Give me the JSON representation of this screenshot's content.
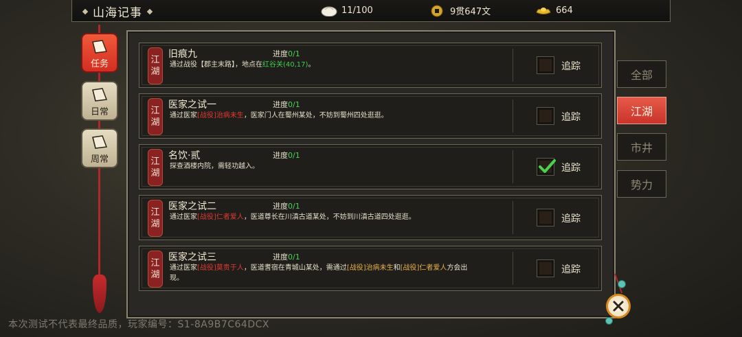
{
  "header": {
    "title": "山海记事",
    "stamina": "11/100",
    "coins": "9贯647文",
    "gold": "664"
  },
  "left_tabs": [
    {
      "label": "任务",
      "active": true
    },
    {
      "label": "日常",
      "active": false
    },
    {
      "label": "周常",
      "active": false
    }
  ],
  "right_tabs": [
    {
      "label": "全部",
      "active": false
    },
    {
      "label": "江湖",
      "active": true
    },
    {
      "label": "市井",
      "active": false
    },
    {
      "label": "势力",
      "active": false
    }
  ],
  "quests": [
    {
      "tag": [
        "江",
        "湖"
      ],
      "name": "旧痕九",
      "progress_label": "进度",
      "progress_value": "0/1",
      "desc": [
        {
          "t": "通过战役【郡主末路】，地点在",
          "c": ""
        },
        {
          "t": "红谷关(40,17)",
          "c": "grn"
        },
        {
          "t": "。",
          "c": ""
        }
      ],
      "tracked": false,
      "track_label": "追踪"
    },
    {
      "tag": [
        "江",
        "湖"
      ],
      "name": "医家之试一",
      "progress_label": "进度",
      "progress_value": "0/1",
      "desc": [
        {
          "t": "通过医家",
          "c": ""
        },
        {
          "t": "[战役]治病未生",
          "c": "red"
        },
        {
          "t": "，医家门人在蜀州某处，不妨到蜀州四处逛逛。",
          "c": ""
        }
      ],
      "tracked": false,
      "track_label": "追踪"
    },
    {
      "tag": [
        "江",
        "湖"
      ],
      "name": "名饮·贰",
      "progress_label": "进度",
      "progress_value": "0/1",
      "desc": [
        {
          "t": "探查酒楼内院，需轻功越入。",
          "c": ""
        }
      ],
      "tracked": true,
      "track_label": "追踪"
    },
    {
      "tag": [
        "江",
        "湖"
      ],
      "name": "医家之试二",
      "progress_label": "进度",
      "progress_value": "0/1",
      "desc": [
        {
          "t": "通过医家",
          "c": ""
        },
        {
          "t": "[战役]仁者爱人",
          "c": "red"
        },
        {
          "t": "，医道尊长在川滇古道某处，不妨到川滇古道四处逛逛。",
          "c": ""
        }
      ],
      "tracked": false,
      "track_label": "追踪"
    },
    {
      "tag": [
        "江",
        "湖"
      ],
      "name": "医家之试三",
      "progress_label": "进度",
      "progress_value": "0/1",
      "desc": [
        {
          "t": "通过医家",
          "c": ""
        },
        {
          "t": "[战役]莫贵于人",
          "c": "red"
        },
        {
          "t": "，医道耆宿在青城山某处，需通过",
          "c": ""
        },
        {
          "t": "[战役]治病未生",
          "c": "gold"
        },
        {
          "t": "和",
          "c": ""
        },
        {
          "t": "[战役]仁者爱人",
          "c": "gold"
        },
        {
          "t": "方会出现。",
          "c": ""
        }
      ],
      "tracked": false,
      "track_label": "追踪"
    }
  ],
  "watermark": "本次测试不代表最终品质，玩家编号：S1-8A9B7C64DCX",
  "colors": {
    "accent_red": "#d32d23",
    "location_green": "#3fcf50",
    "battle_red": "#e03a32",
    "battle_gold": "#e8b14a"
  }
}
